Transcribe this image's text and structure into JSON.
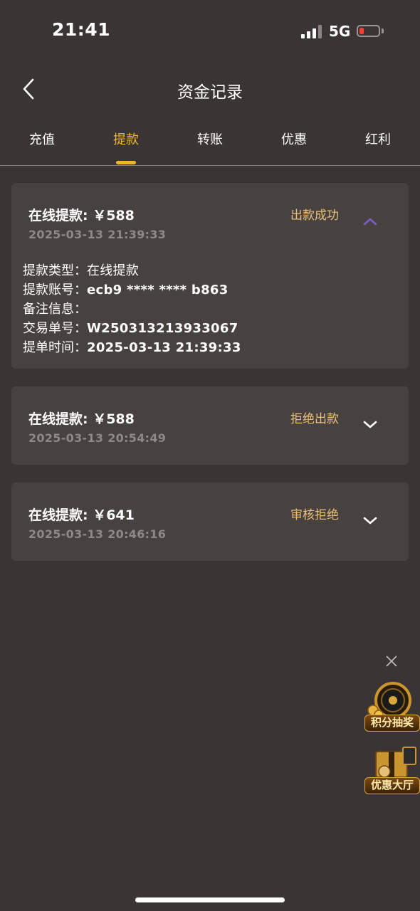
{
  "status_bar": {
    "time": "21:41",
    "network": "5G"
  },
  "header": {
    "title": "资金记录",
    "back_icon": "chevron-left-icon"
  },
  "tabs": [
    {
      "label": "充值",
      "active": false
    },
    {
      "label": "提款",
      "active": true
    },
    {
      "label": "转账",
      "active": false
    },
    {
      "label": "优惠",
      "active": false
    },
    {
      "label": "红利",
      "active": false
    }
  ],
  "records": [
    {
      "title": "在线提款: ￥588",
      "time": "2025-03-13 21:39:33",
      "status": "出款成功",
      "expanded": true,
      "details": [
        {
          "label": "提款类型：",
          "value": "在线提款"
        },
        {
          "label": "提款账号：",
          "value": "ecb9 **** **** b863"
        },
        {
          "label": "备注信息：",
          "value": ""
        },
        {
          "label": "交易单号：",
          "value": "W250313213933067"
        },
        {
          "label": "提单时间：",
          "value": "2025-03-13 21:39:33"
        }
      ]
    },
    {
      "title": "在线提款: ￥588",
      "time": "2025-03-13 20:54:49",
      "status": "拒绝出款",
      "expanded": false
    },
    {
      "title": "在线提款: ￥641",
      "time": "2025-03-13 20:46:16",
      "status": "审核拒绝",
      "expanded": false
    }
  ],
  "floating": {
    "lottery_label": "积分抽奖",
    "promo_label": "优惠大厅"
  },
  "colors": {
    "background": "#3a3534",
    "card": "#474140",
    "accent": "#f0b530",
    "status": "#e8c07a",
    "muted": "#8e8988",
    "chevron_up": "#7b5cc8"
  }
}
